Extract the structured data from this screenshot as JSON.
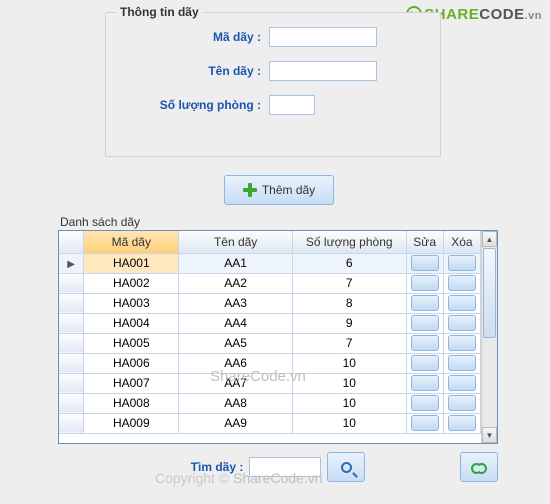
{
  "brand": {
    "share": "SHARE",
    "code": "CODE",
    "suffix": ".vn"
  },
  "form": {
    "group_title": "Thông tin dãy",
    "label_ma": "Mã dãy :",
    "label_ten": "Tên dãy :",
    "label_sl": "Số lượng phòng :",
    "value_ma": "",
    "value_ten": "",
    "value_sl": ""
  },
  "buttons": {
    "add": "Thêm dãy"
  },
  "list": {
    "title": "Danh sách dãy",
    "headers": {
      "c1": "Mã dãy",
      "c2": "Tên dãy",
      "c3": "Số lượng phòng",
      "c4": "Sửa",
      "c5": "Xóa"
    },
    "rows": [
      {
        "c1": "HA001",
        "c2": "AA1",
        "c3": "6"
      },
      {
        "c1": "HA002",
        "c2": "AA2",
        "c3": "7"
      },
      {
        "c1": "HA003",
        "c2": "AA3",
        "c3": "8"
      },
      {
        "c1": "HA004",
        "c2": "AA4",
        "c3": "9"
      },
      {
        "c1": "HA005",
        "c2": "AA5",
        "c3": "7"
      },
      {
        "c1": "HA006",
        "c2": "AA6",
        "c3": "10"
      },
      {
        "c1": "HA007",
        "c2": "AA7",
        "c3": "10"
      },
      {
        "c1": "HA008",
        "c2": "AA8",
        "c3": "10"
      },
      {
        "c1": "HA009",
        "c2": "AA9",
        "c3": "10"
      }
    ],
    "selected_index": 0
  },
  "search": {
    "label": "Tìm dãy :",
    "value": ""
  },
  "watermarks": {
    "mid": "ShareCode.vn",
    "bottom_a": "Copyright © ",
    "bottom_b": "ShareCode.vn"
  }
}
